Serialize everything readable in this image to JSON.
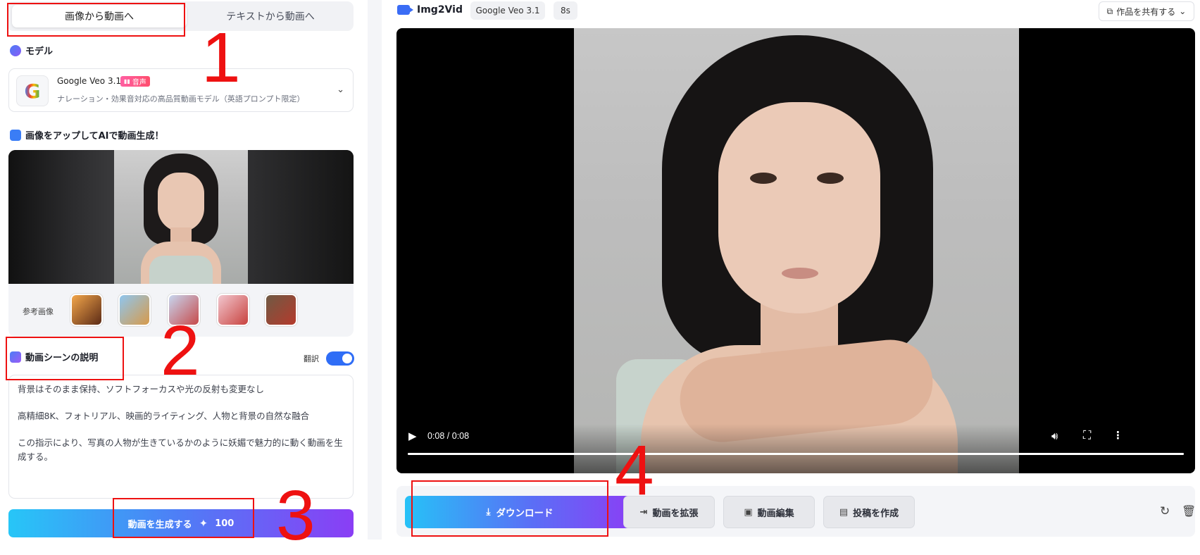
{
  "left": {
    "tabs": [
      {
        "label": "画像から動画へ",
        "active": true
      },
      {
        "label": "テキストから動画へ",
        "active": false
      }
    ],
    "model_section_title": "モデル",
    "model": {
      "name": "Google Veo 3.1",
      "badge": "音声",
      "description": "ナレーション・効果音対応の高品質動画モデル（英語プロンプト限定）",
      "logo_letter": "G"
    },
    "upload_section_title": "画像をアップしてAIで動画生成！",
    "reference_label": "参考画像",
    "reference_thumbs": [
      "thumb-1",
      "thumb-2",
      "thumb-3",
      "thumb-4",
      "thumb-5"
    ],
    "description_title": "動画シーンの説明",
    "translate_label": "翻訳",
    "translate_on": true,
    "prompt_lines": [
      "背景はそのまま保持、ソフトフォーカスや光の反射も変更なし",
      "高精細8K、フォトリアル、映画的ライティング、人物と背景の自然な融合",
      "この指示により、写真の人物が生きているかのように妖媚で魅力的に動く動画を生成する。"
    ],
    "generate_label": "動画を生成する",
    "generate_cost": "100"
  },
  "right": {
    "brand": "Img2Vid",
    "chips": [
      "Google Veo 3.1",
      "8s"
    ],
    "share_label": "作品を共有する",
    "player": {
      "time": "0:08 / 0:08",
      "progress": 1.0
    },
    "actions": {
      "download": "ダウンロード",
      "extend": "動画を拡張",
      "edit": "動画編集",
      "post": "投稿を作成"
    }
  },
  "annotations": [
    "1",
    "2",
    "3",
    "4"
  ],
  "colors": {
    "accent_blue": "#2f6df6",
    "gradient_start": "#27c6f7",
    "gradient_end": "#8a3ef5",
    "annotation_red": "#e11111"
  }
}
